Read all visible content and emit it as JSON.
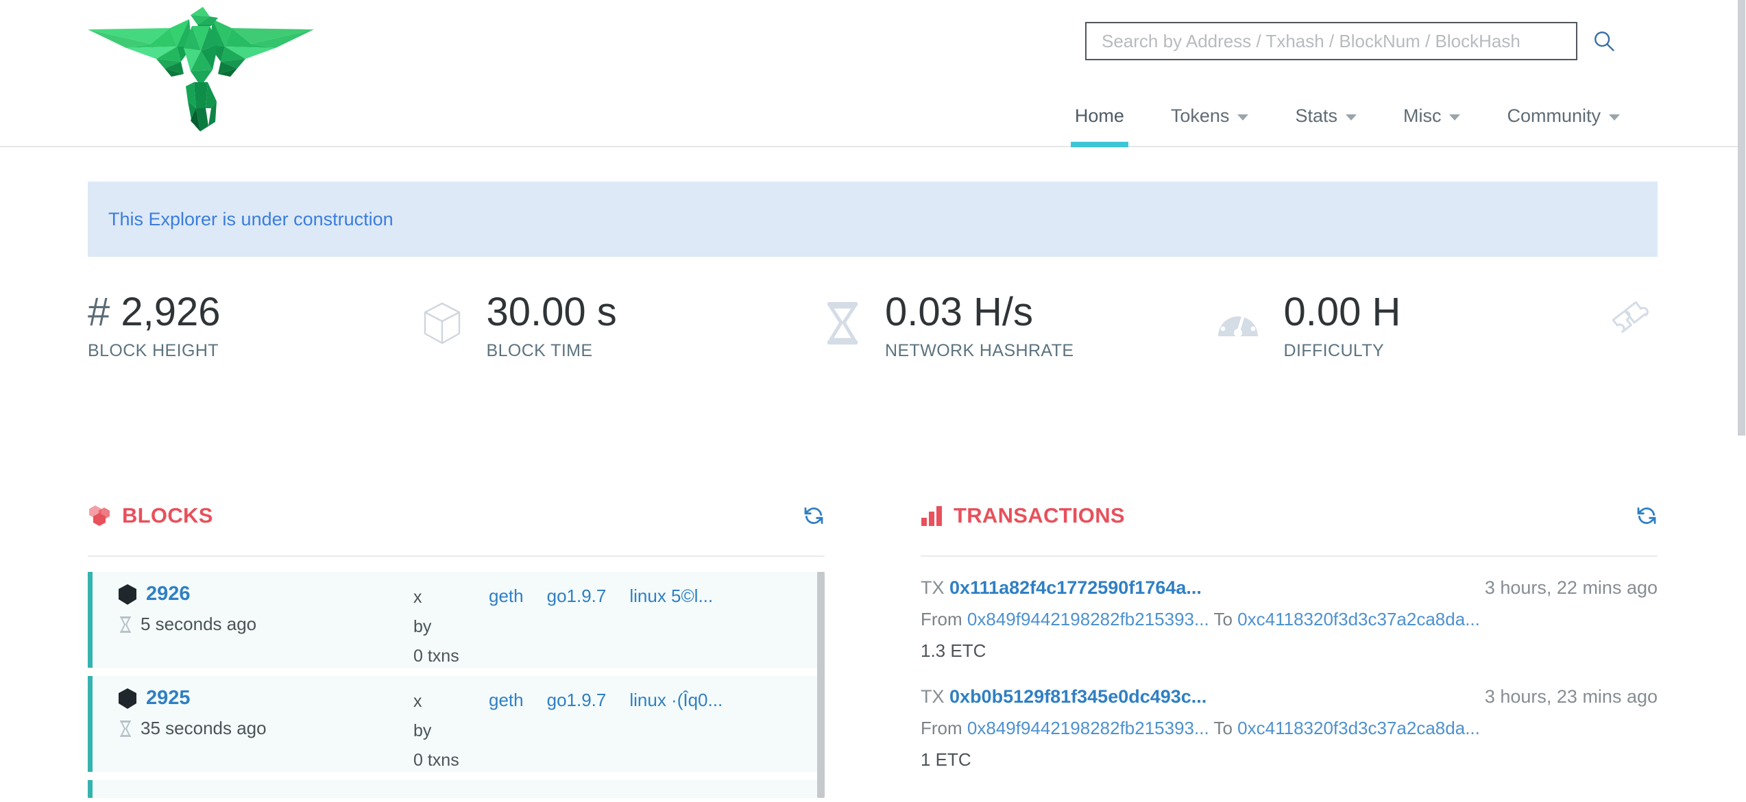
{
  "brand": {
    "logo_name": "low-poly-green-bird-logo"
  },
  "search": {
    "placeholder": "Search by Address / Txhash / BlockNum / BlockHash",
    "value": "",
    "icon": "search-icon"
  },
  "nav": {
    "items": [
      {
        "label": "Home",
        "active": true,
        "caret": false
      },
      {
        "label": "Tokens",
        "active": false,
        "caret": true
      },
      {
        "label": "Stats",
        "active": false,
        "caret": true
      },
      {
        "label": "Misc",
        "active": false,
        "caret": true
      },
      {
        "label": "Community",
        "active": false,
        "caret": true
      }
    ],
    "active_color": "#3ec6d6"
  },
  "alert": {
    "message": "This Explorer is under construction",
    "text_color": "#3b7ddd",
    "bg_color": "#dde9f6"
  },
  "stats": [
    {
      "prefix": "# ",
      "value": "2,926",
      "label": "BLOCK HEIGHT",
      "icon": "cube-icon"
    },
    {
      "prefix": "",
      "value": "30.00 s",
      "label": "BLOCK TIME",
      "icon": "hourglass-icon"
    },
    {
      "prefix": "",
      "value": "0.03 H/s",
      "label": "NETWORK HASHRATE",
      "icon": "gauge-icon"
    },
    {
      "prefix": "",
      "value": "0.00 H",
      "label": "DIFFICULTY",
      "icon": "puzzle-icon"
    }
  ],
  "blocks_panel": {
    "title": "BLOCKS",
    "title_icon": "cubes-icon",
    "refresh_icon": "refresh-icon",
    "rows": [
      {
        "number": "2926",
        "age": "5 seconds ago",
        "miner_label": "x",
        "by_label": "by",
        "txns": "0 txns",
        "client": "geth",
        "version": "go1.9.7",
        "platform": "linux 5©l..."
      },
      {
        "number": "2925",
        "age": "35 seconds ago",
        "miner_label": "x",
        "by_label": "by",
        "txns": "0 txns",
        "client": "geth",
        "version": "go1.9.7",
        "platform": "linux ·(Îq0..."
      }
    ]
  },
  "transactions_panel": {
    "title": "TRANSACTIONS",
    "title_icon": "bar-chart-icon",
    "refresh_icon": "refresh-icon",
    "rows": [
      {
        "tx_prefix": "TX",
        "hash": "0x111a82f4c1772590f1764a...",
        "age": "3 hours, 22 mins ago",
        "from_label": "From",
        "from": "0x849f9442198282fb215393...",
        "to_label": "To",
        "to": "0xc4118320f3d3c37a2ca8da...",
        "value": "1.3 ETC"
      },
      {
        "tx_prefix": "TX",
        "hash": "0xb0b5129f81f345e0dc493c...",
        "age": "3 hours, 23 mins ago",
        "from_label": "From",
        "from": "0x849f9442198282fb215393...",
        "to_label": "To",
        "to": "0xc4118320f3d3c37a2ca8da...",
        "value": "1 ETC"
      }
    ]
  },
  "colors": {
    "accent_teal": "#3ec6d6",
    "panel_title_red": "#e8505b",
    "link_blue": "#2f7fc4",
    "block_border_teal": "#35b3ae"
  }
}
